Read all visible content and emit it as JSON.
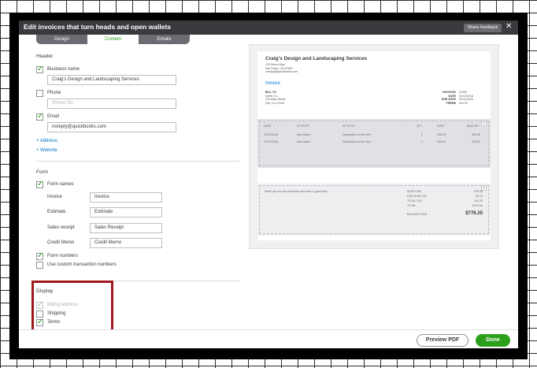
{
  "window": {
    "title": "Edit invoices that turn heads and open wallets",
    "feedback_label": "Share feedback",
    "close_glyph": "✕"
  },
  "tabs": [
    {
      "label": "Design"
    },
    {
      "label": "Content"
    },
    {
      "label": "Emails"
    }
  ],
  "header_section": {
    "title": "Header",
    "business_name": {
      "label": "Business name",
      "value": "Craig's Design and Landscaping Services",
      "checked": true
    },
    "phone": {
      "label": "Phone",
      "placeholder": "Phone No.",
      "checked": false
    },
    "email": {
      "label": "Email",
      "value": "noreply@quickbooks.com",
      "checked": true
    },
    "add_address": "+ Address",
    "add_website": "+ Website"
  },
  "form_section": {
    "title": "Form",
    "form_names_label": "Form names",
    "invoice_label": "Invoice",
    "invoice_value": "Invoice",
    "estimate_label": "Estimate",
    "estimate_value": "Estimate",
    "sales_receipt_label": "Sales receipt",
    "sales_receipt_value": "Sales Receipt",
    "credit_memo_label": "Credit Memo",
    "credit_memo_value": "Credit Memo",
    "form_numbers_label": "Form numbers",
    "custom_numbers_label": "Use custom transaction numbers"
  },
  "display_section": {
    "title": "Display",
    "billing_address_label": "Billing address",
    "shipping_label": "Shipping",
    "terms_label": "Terms"
  },
  "preview": {
    "company": "Craig's Design and Landscaping Services",
    "address_1": "123 Sierra Way",
    "address_2": "San Pablo, CA 87999",
    "email": "noreply@quickbooks.com",
    "doc_title": "Invoice",
    "bill_to": "BILL TO",
    "bill_name": "Smith Co.",
    "bill_addr1": "123 Main Street",
    "bill_addr2": "City, CA 12345",
    "meta_labels": [
      "INVOICE#",
      "DATE",
      "DUE DATE",
      "TERMS"
    ],
    "meta_values": [
      "12345",
      "01/12/2016",
      "02/12/2016",
      "Net 30"
    ],
    "table_headers": [
      "DATE",
      "ACTIVITY",
      "ACTIVITY",
      "QTY",
      "RATE",
      "AMOUNT"
    ],
    "rows": [
      [
        "12/01/2016",
        "Item name",
        "Description of the item",
        "2",
        "225.00",
        "450.00"
      ],
      [
        "01/12/2016",
        "Item name",
        "Description of the item",
        "1",
        "225.00",
        "225.00"
      ]
    ],
    "thanks": "Thank you for your business and have a great day!",
    "totals_labels": [
      "SUBTOTAL",
      "DISCOUNT 5%",
      "TOTAL TAX",
      "TOTAL",
      "BALANCE DUE"
    ],
    "totals_values": [
      "675.00",
      "-33.75",
      "101.29",
      "$742.54",
      "$776.25"
    ],
    "pencil_glyph": "✎"
  },
  "footer": {
    "preview_label": "Preview PDF",
    "done_label": "Done"
  }
}
